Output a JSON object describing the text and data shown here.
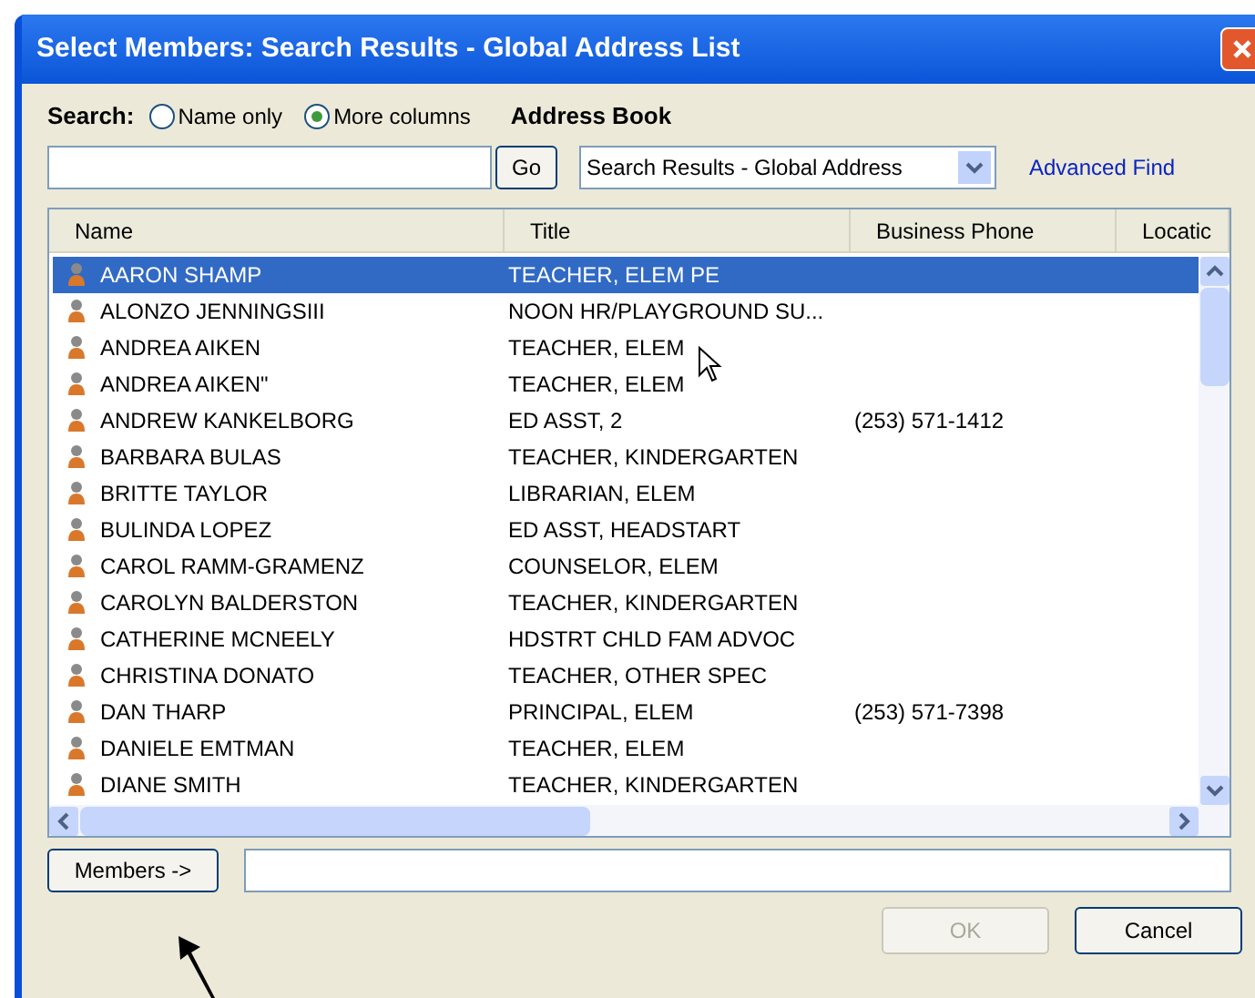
{
  "window": {
    "title": "Select Members: Search Results - Global Address List"
  },
  "search": {
    "label": "Search:",
    "options": [
      {
        "label": "Name only",
        "selected": false
      },
      {
        "label": "More columns",
        "selected": true
      }
    ],
    "go": "Go"
  },
  "address_book": {
    "label": "Address Book",
    "value": "Search Results - Global Address",
    "advanced_find": "Advanced Find"
  },
  "columns": [
    "Name",
    "Title",
    "Business Phone",
    "Locatic"
  ],
  "rows": [
    {
      "name": "AARON SHAMP",
      "title": "TEACHER, ELEM PE",
      "selected": true
    },
    {
      "name": "ALONZO JENNINGSIII",
      "title": "NOON HR/PLAYGROUND SU...",
      "selected": false
    },
    {
      "name": "ANDREA AIKEN",
      "title": "TEACHER, ELEM",
      "selected": false
    },
    {
      "name": "ANDREA AIKEN\"",
      "title": "TEACHER, ELEM",
      "selected": false
    },
    {
      "name": "ANDREW KANKELBORG",
      "title": "ED ASST, 2",
      "phone": "(253) 571-1412",
      "selected": false
    },
    {
      "name": "BARBARA BULAS",
      "title": "TEACHER, KINDERGARTEN",
      "selected": false
    },
    {
      "name": "BRITTE TAYLOR",
      "title": "LIBRARIAN, ELEM",
      "selected": false
    },
    {
      "name": "BULINDA LOPEZ",
      "title": "ED ASST, HEADSTART",
      "selected": false
    },
    {
      "name": "CAROL RAMM-GRAMENZ",
      "title": "COUNSELOR, ELEM",
      "selected": false
    },
    {
      "name": "CAROLYN BALDERSTON",
      "title": "TEACHER, KINDERGARTEN",
      "selected": false
    },
    {
      "name": "CATHERINE MCNEELY",
      "title": "HDSTRT CHLD FAM ADVOC",
      "selected": false
    },
    {
      "name": "CHRISTINA DONATO",
      "title": "TEACHER, OTHER SPEC",
      "selected": false
    },
    {
      "name": "DAN THARP",
      "title": "PRINCIPAL, ELEM",
      "phone": "(253) 571-7398",
      "selected": false
    },
    {
      "name": "DANIELE EMTMAN",
      "title": "TEACHER, ELEM",
      "selected": false
    },
    {
      "name": "DIANE SMITH",
      "title": "TEACHER, KINDERGARTEN",
      "selected": false
    }
  ],
  "members": {
    "button": "Members ->"
  },
  "footer": [
    {
      "label": "OK",
      "disabled": true
    },
    {
      "label": "Cancel",
      "disabled": false
    }
  ]
}
